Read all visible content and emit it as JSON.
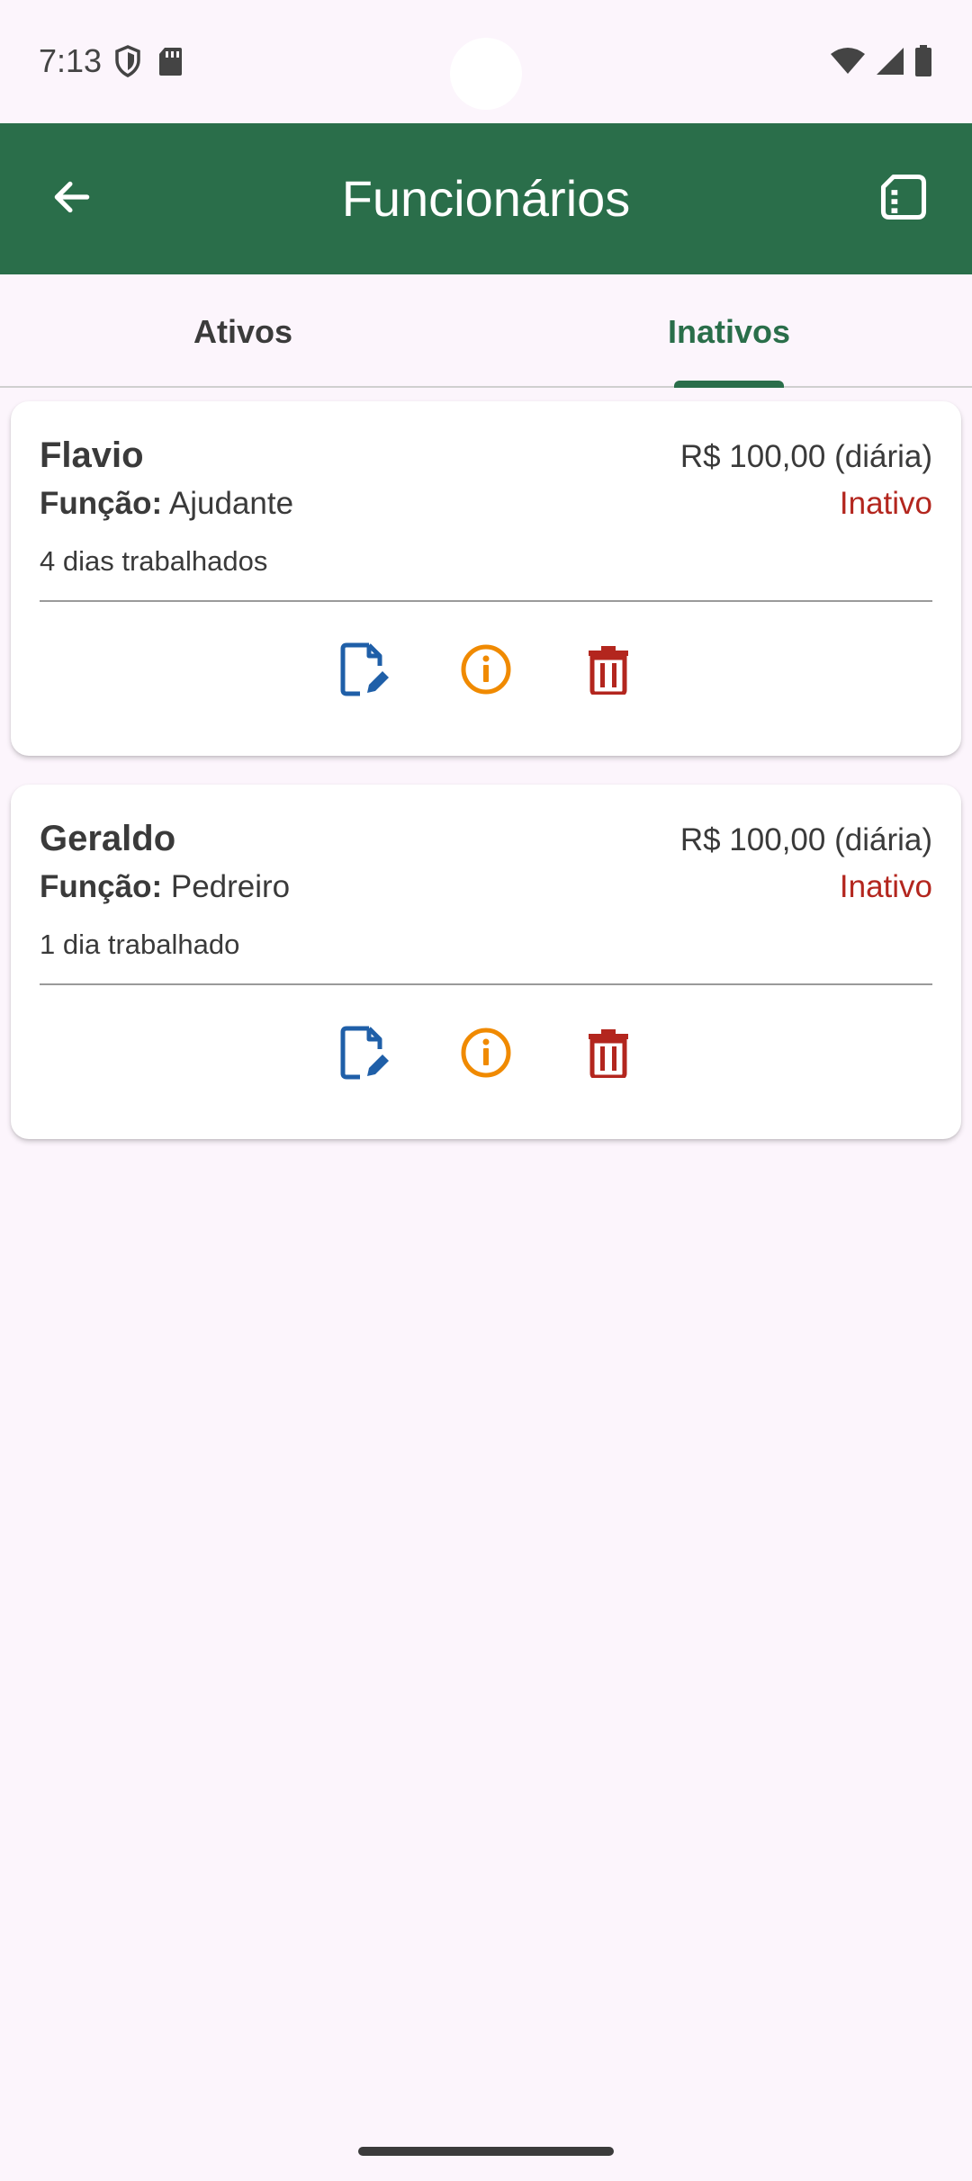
{
  "status_bar": {
    "time": "7:13",
    "left_icons": [
      "shield-icon",
      "sd-card-icon"
    ],
    "right_icons": [
      "wifi-icon",
      "signal-icon",
      "battery-icon"
    ]
  },
  "app_bar": {
    "title": "Funcionários",
    "back_icon": "arrow-back-icon",
    "action_icon": "report-icon",
    "color": "#2a6e4a"
  },
  "tabs": [
    {
      "label": "Ativos",
      "selected": false
    },
    {
      "label": "Inativos",
      "selected": true
    }
  ],
  "employees": [
    {
      "name": "Flavio",
      "rate": "R$ 100,00 (diária)",
      "role_label": "Função:",
      "role": "Ajudante",
      "status": "Inativo",
      "days": "4 dias trabalhados"
    },
    {
      "name": "Geraldo",
      "rate": "R$ 100,00 (diária)",
      "role_label": "Função:",
      "role": "Pedreiro",
      "status": "Inativo",
      "days": "1 dia trabalhado"
    }
  ],
  "actions": {
    "edit_icon": "edit-document-icon",
    "info_icon": "info-icon",
    "delete_icon": "trash-icon",
    "edit_color": "#1f5fa8",
    "info_color": "#f08a00",
    "delete_color": "#b3261e"
  }
}
